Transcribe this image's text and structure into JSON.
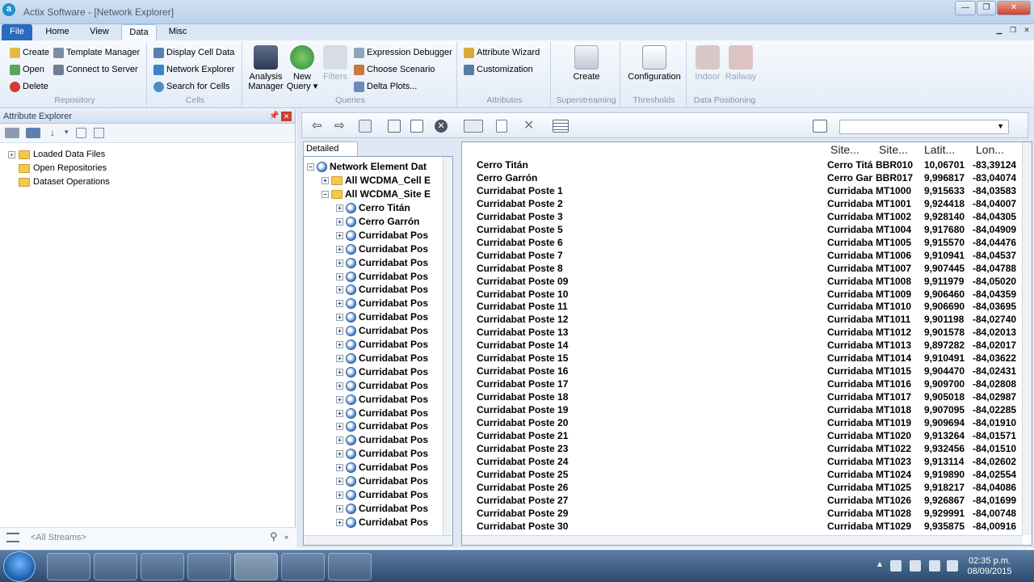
{
  "window": {
    "title": "Actix Software - [Network Explorer]",
    "app_icon": "a"
  },
  "tabs": [
    "File",
    "Home",
    "View",
    "Data",
    "Misc"
  ],
  "active_tab": "Data",
  "ribbon": {
    "repository": {
      "label": "Repository",
      "create": "Create",
      "template_manager": "Template Manager",
      "open": "Open",
      "connect_to_server": "Connect to Server",
      "delete": "Delete"
    },
    "cells": {
      "label": "Cells",
      "display_cell_data": "Display Cell Data",
      "network_explorer": "Network Explorer",
      "search_for_cells": "Search for Cells"
    },
    "queries": {
      "label": "Queries",
      "analysis_manager_1": "Analysis",
      "analysis_manager_2": "Manager",
      "new_query_1": "New",
      "new_query_2": "Query ▾",
      "filters": "Filters",
      "expression_debugger": "Expression Debugger",
      "choose_scenario": "Choose Scenario",
      "delta_plots": "Delta Plots..."
    },
    "attributes": {
      "label": "Attributes",
      "attribute_wizard": "Attribute Wizard",
      "customization": "Customization"
    },
    "superstreaming": {
      "label": "Superstreaming",
      "create": "Create"
    },
    "thresholds": {
      "label": "Thresholds",
      "configuration": "Configuration"
    },
    "data_positioning": {
      "label": "Data Positioning",
      "indoor": "Indoor",
      "railway": "Railway"
    }
  },
  "attribute_explorer": {
    "title": "Attribute Explorer",
    "items": [
      "Loaded Data Files",
      "Open Repositories",
      "Dataset Operations"
    ],
    "stream_placeholder": "<All Streams>"
  },
  "main": {
    "detailed_view_tab": "Detailed View",
    "tree": {
      "root": "Network Element Dat",
      "groups": [
        "All WCDMA_Cell E",
        "All WCDMA_Site E"
      ],
      "nodes": [
        "Cerro Titán",
        "Cerro Garrón",
        "Curridabat Pos",
        "Curridabat Pos",
        "Curridabat Pos",
        "Curridabat Pos",
        "Curridabat Pos",
        "Curridabat Pos",
        "Curridabat Pos",
        "Curridabat Pos",
        "Curridabat Pos",
        "Curridabat Pos",
        "Curridabat Pos",
        "Curridabat Pos",
        "Curridabat Pos",
        "Curridabat Pos",
        "Curridabat Pos",
        "Curridabat Pos",
        "Curridabat Pos",
        "Curridabat Pos",
        "Curridabat Pos",
        "Curridabat Pos",
        "Curridabat Pos",
        "Curridabat Pos"
      ]
    },
    "list": {
      "columns": [
        "Site...",
        "Site...",
        "Latit...",
        "Lon..."
      ],
      "rows": [
        {
          "name": "Cerro Titán",
          "site_name": "Cerro Titá",
          "site_id": "BBR010",
          "lat": "10,06701",
          "lon": "-83,39124"
        },
        {
          "name": "Cerro Garrón",
          "site_name": "Cerro Gar",
          "site_id": "BBR017",
          "lat": "9,996817",
          "lon": "-83,04074"
        },
        {
          "name": "Curridabat Poste 1",
          "site_name": "Curridaba",
          "site_id": "MT1000",
          "lat": "9,915633",
          "lon": "-84,03583"
        },
        {
          "name": "Curridabat Poste 2",
          "site_name": "Curridaba",
          "site_id": "MT1001",
          "lat": "9,924418",
          "lon": "-84,04007"
        },
        {
          "name": "Curridabat Poste 3",
          "site_name": "Curridaba",
          "site_id": "MT1002",
          "lat": "9,928140",
          "lon": "-84,04305"
        },
        {
          "name": "Curridabat Poste 5",
          "site_name": "Curridaba",
          "site_id": "MT1004",
          "lat": "9,917680",
          "lon": "-84,04909"
        },
        {
          "name": "Curridabat Poste 6",
          "site_name": "Curridaba",
          "site_id": "MT1005",
          "lat": "9,915570",
          "lon": "-84,04476"
        },
        {
          "name": "Curridabat Poste 7",
          "site_name": "Curridaba",
          "site_id": "MT1006",
          "lat": "9,910941",
          "lon": "-84,04537"
        },
        {
          "name": "Curridabat Poste 8",
          "site_name": "Curridaba",
          "site_id": "MT1007",
          "lat": "9,907445",
          "lon": "-84,04788"
        },
        {
          "name": "Curridabat Poste 09",
          "site_name": "Curridaba",
          "site_id": "MT1008",
          "lat": "9,911979",
          "lon": "-84,05020"
        },
        {
          "name": "Curridabat Poste 10",
          "site_name": "Curridaba",
          "site_id": "MT1009",
          "lat": "9,906460",
          "lon": "-84,04359"
        },
        {
          "name": "Curridabat Poste 11",
          "site_name": "Curridaba",
          "site_id": "MT1010",
          "lat": "9,906690",
          "lon": "-84,03695"
        },
        {
          "name": "Curridabat Poste 12",
          "site_name": "Curridaba",
          "site_id": "MT1011",
          "lat": "9,901198",
          "lon": "-84,02740"
        },
        {
          "name": "Curridabat Poste 13",
          "site_name": "Curridaba",
          "site_id": "MT1012",
          "lat": "9,901578",
          "lon": "-84,02013"
        },
        {
          "name": "Curridabat Poste 14",
          "site_name": "Curridaba",
          "site_id": "MT1013",
          "lat": "9,897282",
          "lon": "-84,02017"
        },
        {
          "name": "Curridabat Poste 15",
          "site_name": "Curridaba",
          "site_id": "MT1014",
          "lat": "9,910491",
          "lon": "-84,03622"
        },
        {
          "name": "Curridabat Poste 16",
          "site_name": "Curridaba",
          "site_id": "MT1015",
          "lat": "9,904470",
          "lon": "-84,02431"
        },
        {
          "name": "Curridabat Poste 17",
          "site_name": "Curridaba",
          "site_id": "MT1016",
          "lat": "9,909700",
          "lon": "-84,02808"
        },
        {
          "name": "Curridabat Poste 18",
          "site_name": "Curridaba",
          "site_id": "MT1017",
          "lat": "9,905018",
          "lon": "-84,02987"
        },
        {
          "name": "Curridabat Poste 19",
          "site_name": "Curridaba",
          "site_id": "MT1018",
          "lat": "9,907095",
          "lon": "-84,02285"
        },
        {
          "name": "Curridabat Poste 20",
          "site_name": "Curridaba",
          "site_id": "MT1019",
          "lat": "9,909694",
          "lon": "-84,01910"
        },
        {
          "name": "Curridabat Poste 21",
          "site_name": "Curridaba",
          "site_id": "MT1020",
          "lat": "9,913264",
          "lon": "-84,01571"
        },
        {
          "name": "Curridabat Poste 23",
          "site_name": "Curridaba",
          "site_id": "MT1022",
          "lat": "9,932456",
          "lon": "-84,01510"
        },
        {
          "name": "Curridabat Poste 24",
          "site_name": "Curridaba",
          "site_id": "MT1023",
          "lat": "9,913114",
          "lon": "-84,02602"
        },
        {
          "name": "Curridabat Poste 25",
          "site_name": "Curridaba",
          "site_id": "MT1024",
          "lat": "9,919890",
          "lon": "-84,02554"
        },
        {
          "name": "Curridabat Poste 26",
          "site_name": "Curridaba",
          "site_id": "MT1025",
          "lat": "9,918217",
          "lon": "-84,04086"
        },
        {
          "name": "Curridabat Poste 27",
          "site_name": "Curridaba",
          "site_id": "MT1026",
          "lat": "9,926867",
          "lon": "-84,01699"
        },
        {
          "name": "Curridabat Poste 29",
          "site_name": "Curridaba",
          "site_id": "MT1028",
          "lat": "9,929991",
          "lon": "-84,00748"
        },
        {
          "name": "Curridabat Poste 30",
          "site_name": "Curridaba",
          "site_id": "MT1029",
          "lat": "9,935875",
          "lon": "-84,00916"
        }
      ]
    }
  },
  "taskbar": {
    "time": "02:35 p.m.",
    "date": "08/09/2015"
  },
  "colors": {
    "title_bar": "#c4d8ef",
    "file_tab": "#2a6bbf",
    "taskbar": "#2c4a6e"
  }
}
